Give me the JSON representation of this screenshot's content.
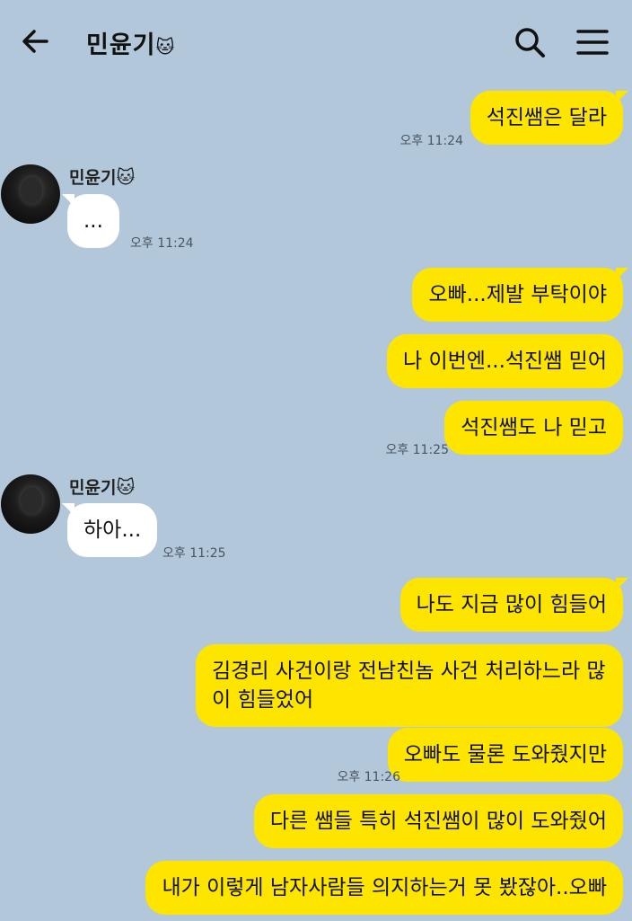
{
  "header": {
    "title": "민윤기",
    "title_emoji": "🐱"
  },
  "messages": [
    {
      "from": "me",
      "text": "석진쌤은 달라",
      "time": "오후 11:24"
    },
    {
      "from": "other",
      "sender": "민윤기",
      "sender_emoji": "🐱",
      "text": "...",
      "time": "오후 11:24"
    },
    {
      "from": "me",
      "text": "오빠...제발 부탁이야"
    },
    {
      "from": "me",
      "text": "나 이번엔...석진쌤 믿어"
    },
    {
      "from": "me",
      "text": "석진쌤도 나 믿고",
      "time": "오후 11:25"
    },
    {
      "from": "other",
      "sender": "민윤기",
      "sender_emoji": "🐱",
      "text": "하아...",
      "time": "오후 11:25"
    },
    {
      "from": "me",
      "text": "나도 지금 많이 힘들어"
    },
    {
      "from": "me",
      "text": "김경리 사건이랑 전남친놈 사건 처리하느라 많이 힘들었어"
    },
    {
      "from": "me",
      "text": "오빠도 물론 도와줬지만",
      "time": "오후 11:26"
    },
    {
      "from": "me",
      "text": "다른 쌤들 특히 석진쌤이 많이 도와줬어"
    },
    {
      "from": "me",
      "text": "내가 이렇게 남자사람들 의지하는거 못 봤잖아..오빠"
    }
  ],
  "colors": {
    "background": "#b2c7d9",
    "my_bubble": "#fee500",
    "other_bubble": "#ffffff"
  },
  "icons": {
    "back": "arrow-left-icon",
    "search": "search-icon",
    "menu": "hamburger-menu-icon"
  }
}
